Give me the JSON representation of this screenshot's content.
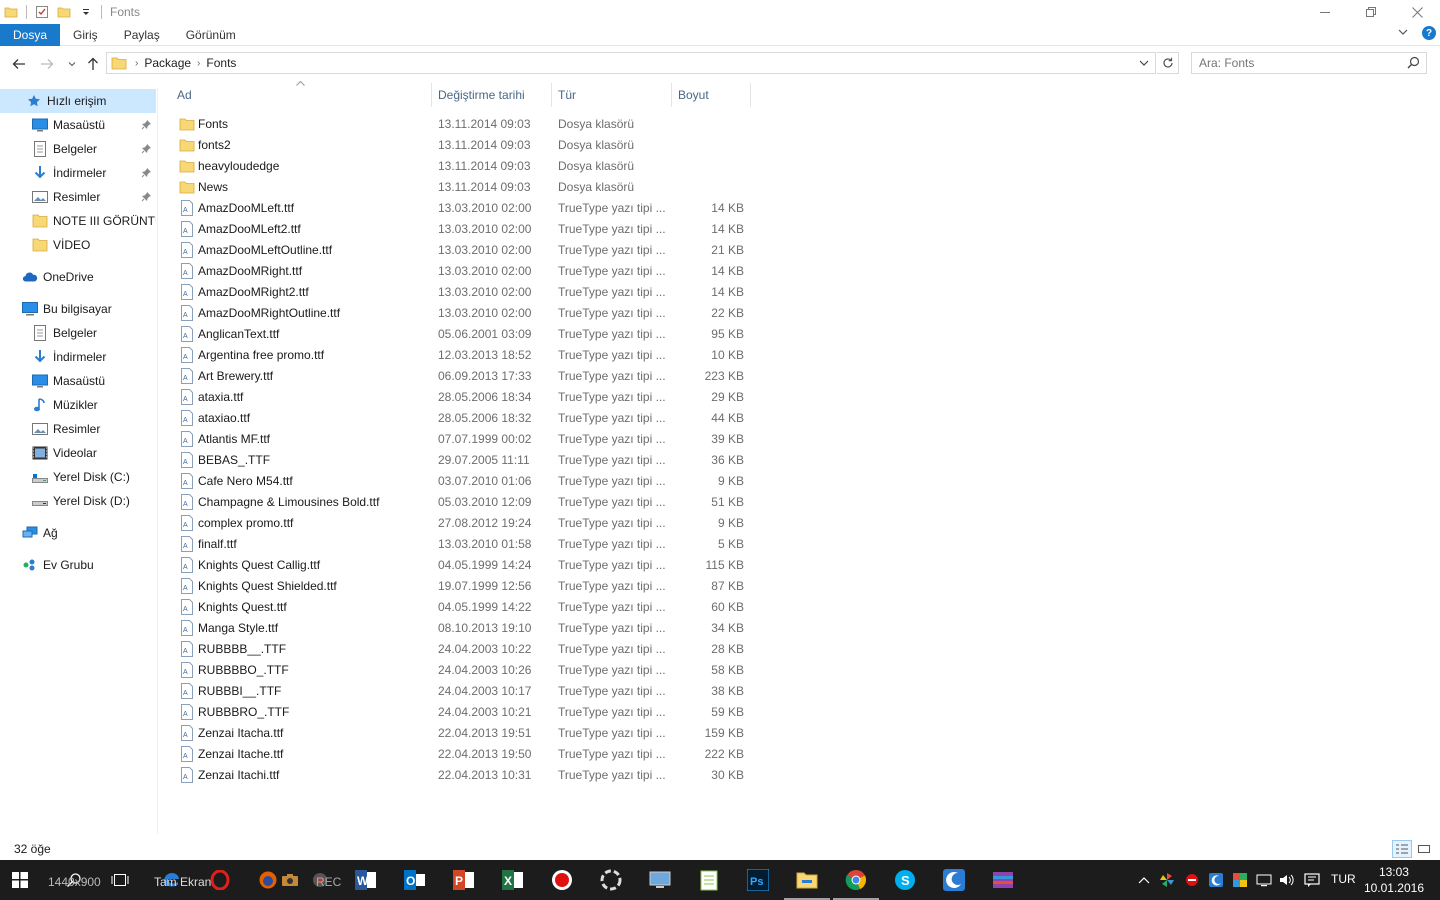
{
  "window": {
    "title": "Fonts",
    "controls": [
      "minimize",
      "maximize",
      "close"
    ]
  },
  "ribbon": {
    "tabs": [
      {
        "label": "Dosya",
        "active": true
      },
      {
        "label": "Giriş",
        "active": false
      },
      {
        "label": "Paylaş",
        "active": false
      },
      {
        "label": "Görünüm",
        "active": false
      }
    ]
  },
  "address": {
    "crumbs": [
      "Package",
      "Fonts"
    ]
  },
  "search": {
    "placeholder": "Ara: Fonts"
  },
  "sidebar": {
    "items": [
      {
        "label": "Hızlı erişim",
        "icon": "star-icon",
        "pinned": false,
        "selected": true
      },
      {
        "label": "Masaüstü",
        "icon": "desktop-icon",
        "pinned": true,
        "selected": false
      },
      {
        "label": "Belgeler",
        "icon": "documents-icon",
        "pinned": true,
        "selected": false
      },
      {
        "label": "İndirmeler",
        "icon": "download-icon",
        "pinned": true,
        "selected": false
      },
      {
        "label": "Resimler",
        "icon": "pictures-icon",
        "pinned": true,
        "selected": false
      },
      {
        "label": "NOTE III GÖRÜNTÜ",
        "icon": "folder-icon",
        "pinned": false,
        "selected": false
      },
      {
        "label": "VİDEO",
        "icon": "folder-icon",
        "pinned": false,
        "selected": false
      },
      {
        "label": "OneDrive",
        "icon": "onedrive-icon",
        "pinned": false,
        "selected": false
      },
      {
        "label": "Bu bilgisayar",
        "icon": "computer-icon",
        "pinned": false,
        "selected": false
      },
      {
        "label": "Belgeler",
        "icon": "documents-icon",
        "pinned": false,
        "selected": false
      },
      {
        "label": "İndirmeler",
        "icon": "download-icon",
        "pinned": false,
        "selected": false
      },
      {
        "label": "Masaüstü",
        "icon": "desktop-icon",
        "pinned": false,
        "selected": false
      },
      {
        "label": "Müzikler",
        "icon": "music-icon",
        "pinned": false,
        "selected": false
      },
      {
        "label": "Resimler",
        "icon": "pictures-icon",
        "pinned": false,
        "selected": false
      },
      {
        "label": "Videolar",
        "icon": "videos-icon",
        "pinned": false,
        "selected": false
      },
      {
        "label": "Yerel Disk (C:)",
        "icon": "drive-c-icon",
        "pinned": false,
        "selected": false
      },
      {
        "label": "Yerel Disk (D:)",
        "icon": "drive-icon",
        "pinned": false,
        "selected": false
      },
      {
        "label": "Ağ",
        "icon": "network-icon",
        "pinned": false,
        "selected": false
      },
      {
        "label": "Ev Grubu",
        "icon": "homegroup-icon",
        "pinned": false,
        "selected": false
      }
    ]
  },
  "columns": [
    {
      "label": "Ad"
    },
    {
      "label": "Değiştirme tarihi"
    },
    {
      "label": "Tür"
    },
    {
      "label": "Boyut"
    }
  ],
  "files": [
    {
      "name": "Fonts",
      "date": "13.11.2014 09:03",
      "type": "Dosya klasörü",
      "size": "",
      "kind": "folder"
    },
    {
      "name": "fonts2",
      "date": "13.11.2014 09:03",
      "type": "Dosya klasörü",
      "size": "",
      "kind": "folder"
    },
    {
      "name": "heavyloudedge",
      "date": "13.11.2014 09:03",
      "type": "Dosya klasörü",
      "size": "",
      "kind": "folder"
    },
    {
      "name": "News",
      "date": "13.11.2014 09:03",
      "type": "Dosya klasörü",
      "size": "",
      "kind": "folder"
    },
    {
      "name": "AmazDooMLeft.ttf",
      "date": "13.03.2010 02:00",
      "type": "TrueType yazı tipi ...",
      "size": "14 KB",
      "kind": "font"
    },
    {
      "name": "AmazDooMLeft2.ttf",
      "date": "13.03.2010 02:00",
      "type": "TrueType yazı tipi ...",
      "size": "14 KB",
      "kind": "font"
    },
    {
      "name": "AmazDooMLeftOutline.ttf",
      "date": "13.03.2010 02:00",
      "type": "TrueType yazı tipi ...",
      "size": "21 KB",
      "kind": "font"
    },
    {
      "name": "AmazDooMRight.ttf",
      "date": "13.03.2010 02:00",
      "type": "TrueType yazı tipi ...",
      "size": "14 KB",
      "kind": "font"
    },
    {
      "name": "AmazDooMRight2.ttf",
      "date": "13.03.2010 02:00",
      "type": "TrueType yazı tipi ...",
      "size": "14 KB",
      "kind": "font"
    },
    {
      "name": "AmazDooMRightOutline.ttf",
      "date": "13.03.2010 02:00",
      "type": "TrueType yazı tipi ...",
      "size": "22 KB",
      "kind": "font"
    },
    {
      "name": "AnglicanText.ttf",
      "date": "05.06.2001 03:09",
      "type": "TrueType yazı tipi ...",
      "size": "95 KB",
      "kind": "font"
    },
    {
      "name": "Argentina free promo.ttf",
      "date": "12.03.2013 18:52",
      "type": "TrueType yazı tipi ...",
      "size": "10 KB",
      "kind": "font"
    },
    {
      "name": "Art Brewery.ttf",
      "date": "06.09.2013 17:33",
      "type": "TrueType yazı tipi ...",
      "size": "223 KB",
      "kind": "font"
    },
    {
      "name": "ataxia.ttf",
      "date": "28.05.2006 18:34",
      "type": "TrueType yazı tipi ...",
      "size": "29 KB",
      "kind": "font"
    },
    {
      "name": "ataxiao.ttf",
      "date": "28.05.2006 18:32",
      "type": "TrueType yazı tipi ...",
      "size": "44 KB",
      "kind": "font"
    },
    {
      "name": "Atlantis MF.ttf",
      "date": "07.07.1999 00:02",
      "type": "TrueType yazı tipi ...",
      "size": "39 KB",
      "kind": "font"
    },
    {
      "name": "BEBAS_.TTF",
      "date": "29.07.2005 11:11",
      "type": "TrueType yazı tipi ...",
      "size": "36 KB",
      "kind": "font"
    },
    {
      "name": "Cafe Nero M54.ttf",
      "date": "03.07.2010 01:06",
      "type": "TrueType yazı tipi ...",
      "size": "9 KB",
      "kind": "font"
    },
    {
      "name": "Champagne & Limousines Bold.ttf",
      "date": "05.03.2010 12:09",
      "type": "TrueType yazı tipi ...",
      "size": "51 KB",
      "kind": "font"
    },
    {
      "name": "complex promo.ttf",
      "date": "27.08.2012 19:24",
      "type": "TrueType yazı tipi ...",
      "size": "9 KB",
      "kind": "font"
    },
    {
      "name": "finalf.ttf",
      "date": "13.03.2010 01:58",
      "type": "TrueType yazı tipi ...",
      "size": "5 KB",
      "kind": "font"
    },
    {
      "name": "Knights Quest Callig.ttf",
      "date": "04.05.1999 14:24",
      "type": "TrueType yazı tipi ...",
      "size": "115 KB",
      "kind": "font"
    },
    {
      "name": "Knights Quest Shielded.ttf",
      "date": "19.07.1999 12:56",
      "type": "TrueType yazı tipi ...",
      "size": "87 KB",
      "kind": "font"
    },
    {
      "name": "Knights Quest.ttf",
      "date": "04.05.1999 14:22",
      "type": "TrueType yazı tipi ...",
      "size": "60 KB",
      "kind": "font"
    },
    {
      "name": "Manga Style.ttf",
      "date": "08.10.2013 19:10",
      "type": "TrueType yazı tipi ...",
      "size": "34 KB",
      "kind": "font"
    },
    {
      "name": "RUBBBB__.TTF",
      "date": "24.04.2003 10:22",
      "type": "TrueType yazı tipi ...",
      "size": "28 KB",
      "kind": "font"
    },
    {
      "name": "RUBBBBO_.TTF",
      "date": "24.04.2003 10:26",
      "type": "TrueType yazı tipi ...",
      "size": "58 KB",
      "kind": "font"
    },
    {
      "name": "RUBBBI__.TTF",
      "date": "24.04.2003 10:17",
      "type": "TrueType yazı tipi ...",
      "size": "38 KB",
      "kind": "font"
    },
    {
      "name": "RUBBBRO_.TTF",
      "date": "24.04.2003 10:21",
      "type": "TrueType yazı tipi ...",
      "size": "59 KB",
      "kind": "font"
    },
    {
      "name": "Zenzai Itacha.ttf",
      "date": "22.04.2013 19:51",
      "type": "TrueType yazı tipi ...",
      "size": "159 KB",
      "kind": "font"
    },
    {
      "name": "Zenzai Itache.ttf",
      "date": "22.04.2013 19:50",
      "type": "TrueType yazı tipi ...",
      "size": "222 KB",
      "kind": "font"
    },
    {
      "name": "Zenzai Itachi.ttf",
      "date": "22.04.2013 10:31",
      "type": "TrueType yazı tipi ...",
      "size": "30 KB",
      "kind": "font"
    }
  ],
  "status": {
    "item_count": "32 öğe"
  },
  "taskbar": {
    "search_text": "1440x900",
    "tam_ekran_text": "Tam Ekran",
    "rec_text": "REC",
    "language": "TUR",
    "time": "13:03",
    "date": "10.01.2016"
  },
  "colors": {
    "accent": "#1979ca",
    "selection": "#cce8ff",
    "folder": "#f8d775",
    "taskbar": "#1c1c1c",
    "header_text": "#4a6785"
  }
}
